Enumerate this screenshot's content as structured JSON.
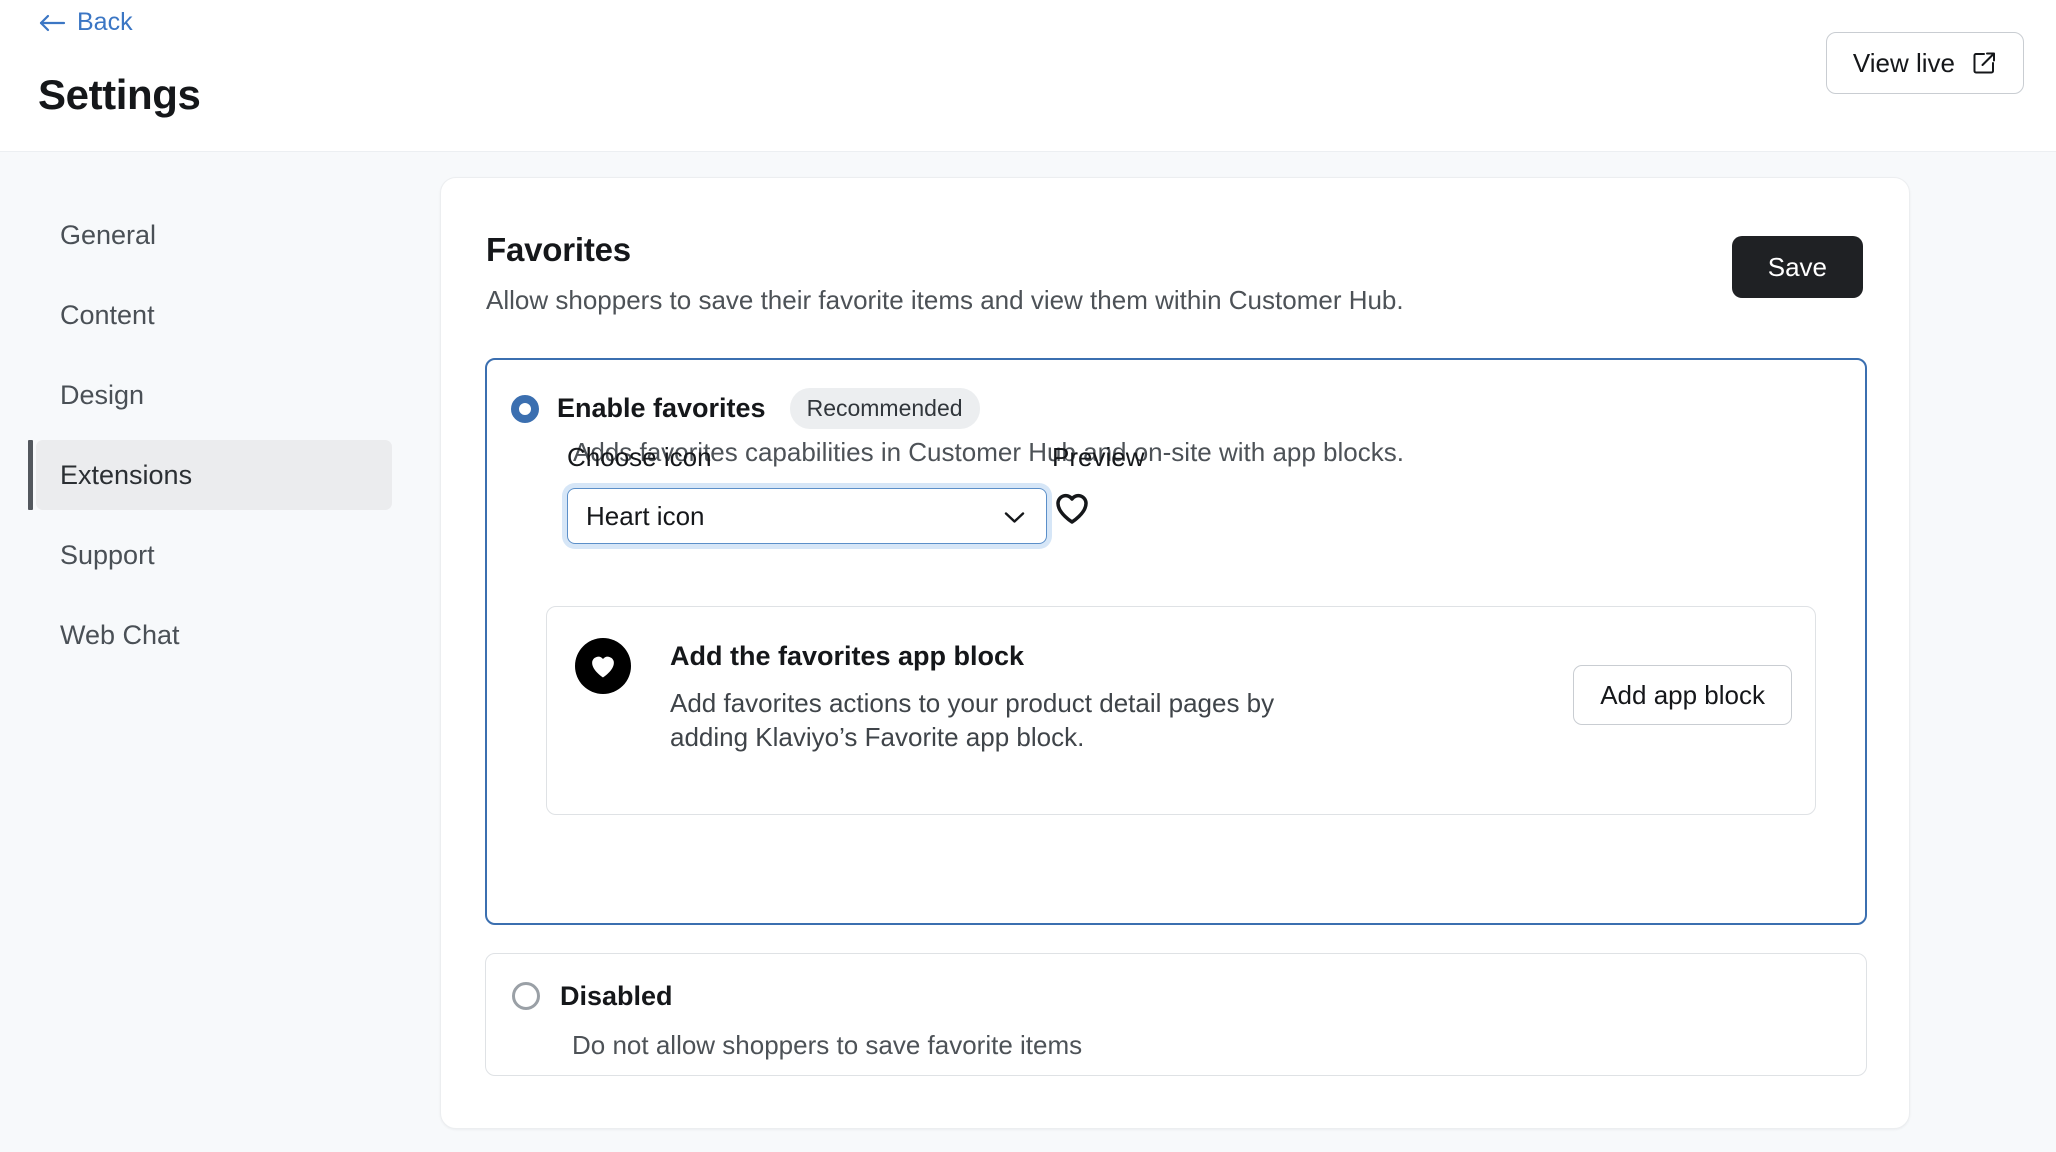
{
  "header": {
    "back_label": "Back",
    "back_icon": "arrow-left-icon",
    "title": "Settings",
    "view_live_label": "View live",
    "view_live_icon": "external-link-icon"
  },
  "sidebar": {
    "items": [
      {
        "label": "General",
        "active": false
      },
      {
        "label": "Content",
        "active": false
      },
      {
        "label": "Design",
        "active": false
      },
      {
        "label": "Extensions",
        "active": true
      },
      {
        "label": "Support",
        "active": false
      },
      {
        "label": "Web Chat",
        "active": false
      }
    ]
  },
  "card": {
    "title": "Favorites",
    "subtitle": "Allow shoppers to save their favorite items and view them within Customer Hub.",
    "save_label": "Save"
  },
  "enable_option": {
    "selected": true,
    "title": "Enable favorites",
    "badge": "Recommended",
    "description": "Adds favorites capabilities in Customer Hub and on-site with app blocks.",
    "icon_field_label": "Choose icon",
    "icon_select_value": "Heart icon",
    "icon_select_chevron": "chevron-down-icon",
    "preview_label": "Preview",
    "preview_icon": "heart-outline-icon",
    "app_block": {
      "icon": "heart-filled-circle-icon",
      "title": "Add the favorites app block",
      "description": "Add favorites actions to your product detail pages by adding Klaviyo’s Favorite app block.",
      "button_label": "Add app block"
    }
  },
  "disabled_option": {
    "selected": false,
    "title": "Disabled",
    "description": "Do not allow shoppers to save favorite items"
  },
  "colors": {
    "accent_blue": "#3b6fb0",
    "link_blue": "#3b76c4",
    "dark": "#1f2124",
    "page_bg": "#f7f9fb"
  }
}
